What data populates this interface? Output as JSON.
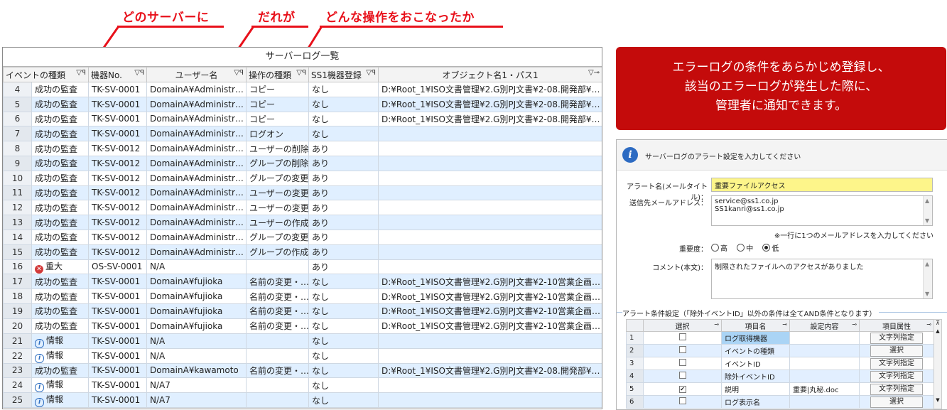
{
  "callouts": {
    "c1": "どのサーバーに",
    "c2": "だれが",
    "c3": "どんな操作をおこなったか"
  },
  "grid": {
    "title": "サーバーログ一覧",
    "headers": [
      "イベントの種類",
      "機器No.",
      "ユーザー名",
      "操作の種類",
      "SS1機器登録",
      "オブジェクト名1・パス1"
    ],
    "rows": [
      {
        "n": "4",
        "type": "成功の監査",
        "sev": "",
        "dev": "TK-SV-0001",
        "user": "DomainA¥Administr…",
        "op": "コピー",
        "reg": "なし",
        "obj": "D:¥Root_1¥ISO文書管理¥2.G別PJ文書¥2-08.開発部¥…"
      },
      {
        "n": "5",
        "type": "成功の監査",
        "sev": "",
        "dev": "TK-SV-0001",
        "user": "DomainA¥Administr…",
        "op": "コピー",
        "reg": "なし",
        "obj": "D:¥Root_1¥ISO文書管理¥2.G別PJ文書¥2-08.開発部¥…"
      },
      {
        "n": "6",
        "type": "成功の監査",
        "sev": "",
        "dev": "TK-SV-0001",
        "user": "DomainA¥Administr…",
        "op": "コピー",
        "reg": "なし",
        "obj": "D:¥Root_1¥ISO文書管理¥2.G別PJ文書¥2-08.開発部¥…"
      },
      {
        "n": "7",
        "type": "成功の監査",
        "sev": "",
        "dev": "TK-SV-0001",
        "user": "DomainA¥Administr…",
        "op": "ログオン",
        "reg": "なし",
        "obj": ""
      },
      {
        "n": "8",
        "type": "成功の監査",
        "sev": "",
        "dev": "TK-SV-0012",
        "user": "DomainA¥Administr…",
        "op": "ユーザーの削除",
        "reg": "あり",
        "obj": ""
      },
      {
        "n": "9",
        "type": "成功の監査",
        "sev": "",
        "dev": "TK-SV-0012",
        "user": "DomainA¥Administr…",
        "op": "グループの削除",
        "reg": "あり",
        "obj": ""
      },
      {
        "n": "10",
        "type": "成功の監査",
        "sev": "",
        "dev": "TK-SV-0012",
        "user": "DomainA¥Administr…",
        "op": "グループの変更",
        "reg": "あり",
        "obj": ""
      },
      {
        "n": "11",
        "type": "成功の監査",
        "sev": "",
        "dev": "TK-SV-0012",
        "user": "DomainA¥Administr…",
        "op": "ユーザーの変更",
        "reg": "あり",
        "obj": ""
      },
      {
        "n": "12",
        "type": "成功の監査",
        "sev": "",
        "dev": "TK-SV-0012",
        "user": "DomainA¥Administr…",
        "op": "ユーザーの変更",
        "reg": "あり",
        "obj": ""
      },
      {
        "n": "13",
        "type": "成功の監査",
        "sev": "",
        "dev": "TK-SV-0012",
        "user": "DomainA¥Administr…",
        "op": "ユーザーの作成",
        "reg": "あり",
        "obj": ""
      },
      {
        "n": "14",
        "type": "成功の監査",
        "sev": "",
        "dev": "TK-SV-0012",
        "user": "DomainA¥Administr…",
        "op": "グループの変更",
        "reg": "あり",
        "obj": ""
      },
      {
        "n": "15",
        "type": "成功の監査",
        "sev": "",
        "dev": "TK-SV-0012",
        "user": "DomainA¥Administr…",
        "op": "グループの作成",
        "reg": "あり",
        "obj": ""
      },
      {
        "n": "16",
        "type": "重大",
        "sev": "critical",
        "dev": "OS-SV-0001",
        "user": "N/A",
        "op": "",
        "reg": "あり",
        "obj": ""
      },
      {
        "n": "17",
        "type": "成功の監査",
        "sev": "",
        "dev": "TK-SV-0001",
        "user": "DomainA¥fujioka",
        "op": "名前の変更・…",
        "reg": "なし",
        "obj": "D:¥Root_1¥ISO文書管理¥2.G別PJ文書¥2-10営業企画…"
      },
      {
        "n": "18",
        "type": "成功の監査",
        "sev": "",
        "dev": "TK-SV-0001",
        "user": "DomainA¥fujioka",
        "op": "名前の変更・…",
        "reg": "なし",
        "obj": "D:¥Root_1¥ISO文書管理¥2.G別PJ文書¥2-10営業企画…"
      },
      {
        "n": "19",
        "type": "成功の監査",
        "sev": "",
        "dev": "TK-SV-0001",
        "user": "DomainA¥fujioka",
        "op": "名前の変更・…",
        "reg": "なし",
        "obj": "D:¥Root_1¥ISO文書管理¥2.G別PJ文書¥2-10営業企画…"
      },
      {
        "n": "20",
        "type": "成功の監査",
        "sev": "",
        "dev": "TK-SV-0001",
        "user": "DomainA¥fujioka",
        "op": "名前の変更・…",
        "reg": "なし",
        "obj": "D:¥Root_1¥ISO文書管理¥2.G別PJ文書¥2-10営業企画…"
      },
      {
        "n": "21",
        "type": "情報",
        "sev": "info",
        "dev": "TK-SV-0001",
        "user": "N/A",
        "op": "",
        "reg": "なし",
        "obj": ""
      },
      {
        "n": "22",
        "type": "情報",
        "sev": "info",
        "dev": "TK-SV-0001",
        "user": "N/A",
        "op": "",
        "reg": "なし",
        "obj": ""
      },
      {
        "n": "23",
        "type": "成功の監査",
        "sev": "",
        "dev": "TK-SV-0001",
        "user": "DomainA¥kawamoto",
        "op": "名前の変更・…",
        "reg": "なし",
        "obj": "D:¥Root_1¥ISO文書管理¥2.G別PJ文書¥2-08.開発部¥…"
      },
      {
        "n": "24",
        "type": "情報",
        "sev": "info",
        "dev": "TK-SV-0001",
        "user": "N/A7",
        "op": "",
        "reg": "なし",
        "obj": ""
      },
      {
        "n": "25",
        "type": "情報",
        "sev": "info",
        "dev": "TK-SV-0001",
        "user": "N/A7",
        "op": "",
        "reg": "なし",
        "obj": ""
      }
    ]
  },
  "notice": {
    "line1": "エラーログの条件をあらかじめ登録し、",
    "line2": "該当のエラーログが発生した際に、",
    "line3": "管理者に通知できます。"
  },
  "dialog": {
    "message": "サーバーログのアラート設定を入力してください",
    "alert_name_label": "アラート名(メールタイトル)：",
    "alert_name_value": "重要ファイルアクセス",
    "mail_label": "送信先メールアドレス：",
    "mail_line1": "service@ss1.co.jp",
    "mail_line2": "SS1kanri@ss1.co.jp",
    "mail_note": "※一行に1つのメールアドレスを入力してください",
    "importance_label": "重要度：",
    "importance_options": [
      "高",
      "中",
      "低"
    ],
    "importance_selected": "低",
    "comment_label": "コメント(本文)：",
    "comment_value": "制限されたファイルへのアクセスがありました",
    "cond_legend": "アラート条件設定（「除外イベントID」以外の条件は全てAND条件となります）",
    "cond_headers": [
      "選択",
      "項目名",
      "設定内容",
      "項目属性"
    ],
    "cond_rows": [
      {
        "i": "1",
        "checked": false,
        "name": "ログ取得機器",
        "value": "",
        "attr": "文字列指定"
      },
      {
        "i": "2",
        "checked": false,
        "name": "イベントの種類",
        "value": "",
        "attr": "選択"
      },
      {
        "i": "3",
        "checked": false,
        "name": "イベントID",
        "value": "",
        "attr": "文字列指定"
      },
      {
        "i": "4",
        "checked": false,
        "name": "除外イベントID",
        "value": "",
        "attr": "文字列指定"
      },
      {
        "i": "5",
        "checked": true,
        "name": "説明",
        "value": "重要|丸秘.doc",
        "attr": "文字列指定"
      },
      {
        "i": "6",
        "checked": false,
        "name": "ログ表示名",
        "value": "",
        "attr": "選択"
      }
    ]
  }
}
